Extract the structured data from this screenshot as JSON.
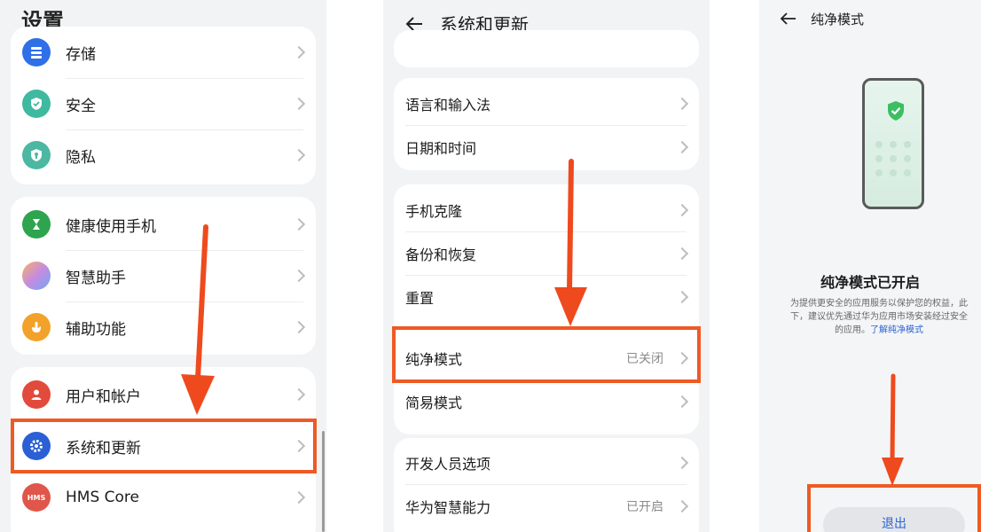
{
  "colors": {
    "accent_red": "#ee5a24",
    "link_blue": "#2b63d4"
  },
  "panel1": {
    "title": "设置",
    "groups": [
      [
        {
          "label": "存储",
          "icon": "storage-icon",
          "color": "#2f6fe8"
        },
        {
          "label": "安全",
          "icon": "security-shield-icon",
          "color": "#3fb99f"
        },
        {
          "label": "隐私",
          "icon": "privacy-shield-icon",
          "color": "#4cb7a2"
        }
      ],
      [
        {
          "label": "健康使用手机",
          "icon": "hourglass-icon",
          "color": "#2ea44f"
        },
        {
          "label": "智慧助手",
          "icon": "assistant-orb-icon",
          "color": "#c58be0"
        },
        {
          "label": "辅助功能",
          "icon": "accessibility-hand-icon",
          "color": "#f2a22a"
        }
      ],
      [
        {
          "label": "用户和帐户",
          "icon": "user-icon",
          "color": "#e24a3b"
        },
        {
          "label": "系统和更新",
          "icon": "system-gear-icon",
          "color": "#2a5fd6"
        },
        {
          "label": "HMS Core",
          "icon": "hms-icon",
          "color": "#e0564a"
        }
      ]
    ],
    "hms_badge": "HMS"
  },
  "panel2": {
    "title": "系统和更新",
    "group1": [
      "语言和输入法",
      "日期和时间"
    ],
    "group2": [
      "手机克隆",
      "备份和恢复",
      "重置"
    ],
    "pure_mode": {
      "label": "纯净模式",
      "value": "已关闭"
    },
    "simple_mode": {
      "label": "简易模式"
    },
    "group4": [
      {
        "label": "开发人员选项",
        "value": ""
      },
      {
        "label": "华为智慧能力",
        "value": "已开启"
      }
    ]
  },
  "panel3": {
    "title": "纯净模式",
    "heading": "纯净模式已开启",
    "desc_line1": "为提供更安全的应用服务以保护您的权益，此",
    "desc_line2": "下，建议优先通过华为应用市场安装经过安全",
    "desc_line3_prefix": "的应用。",
    "desc_link": "了解纯净模式",
    "exit_label": "退出"
  }
}
